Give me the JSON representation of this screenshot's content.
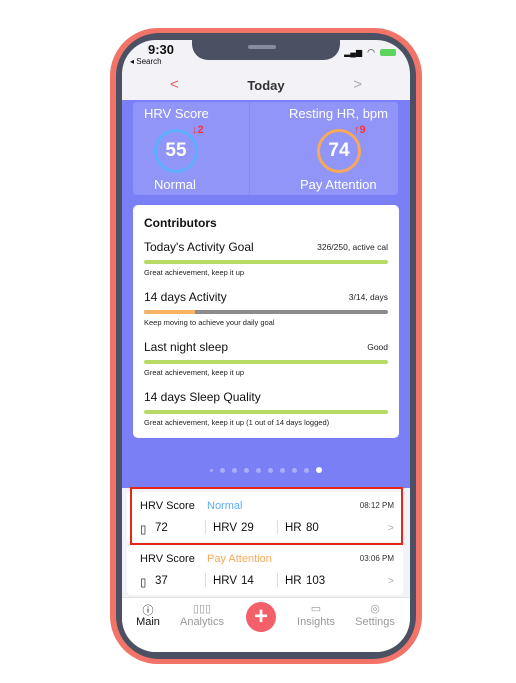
{
  "status": {
    "time": "9:30",
    "back": "◂ Search"
  },
  "nav": {
    "prev": "<",
    "title": "Today",
    "next": ">"
  },
  "hrv": {
    "label": "HRV Score",
    "value": "55",
    "delta": "↓2",
    "status": "Normal",
    "ring_color": "#5aaefc"
  },
  "rhr": {
    "label": "Resting HR, bpm",
    "value": "74",
    "delta": "↑9",
    "status": "Pay Attention",
    "ring_color": "#f7a95a"
  },
  "contributors": {
    "title": "Contributors",
    "items": [
      {
        "name": "Today's Activity Goal",
        "value": "326/250, active cal",
        "progress": 1.0,
        "color": "#b8d964",
        "message": "Great achievement, keep it up"
      },
      {
        "name": "14 days Activity",
        "value": "3/14, days",
        "progress": 0.21,
        "color": "#f7b265",
        "message": "Keep moving to achieve your daily goal"
      },
      {
        "name": "Last night sleep",
        "value": "Good",
        "progress": 1.0,
        "color": "#b8d964",
        "message": "Great achievement, keep it up"
      },
      {
        "name": "14 days Sleep Quality",
        "value": "",
        "progress": 1.0,
        "color": "#b8d964",
        "message": "Great achievement, keep it up (1 out of 14 days logged)"
      }
    ]
  },
  "pager": {
    "count": 10,
    "active": 9
  },
  "entries": [
    {
      "label": "HRV Score",
      "status": "Normal",
      "status_color": "#5aaefc",
      "time": "08:12 PM",
      "score": "72",
      "hrv_label": "HRV",
      "hrv": "29",
      "hr_label": "HR",
      "hr": "80",
      "chevron": ">"
    },
    {
      "label": "HRV Score",
      "status": "Pay Attention",
      "status_color": "#f7a95a",
      "time": "03:06 PM",
      "score": "37",
      "hrv_label": "HRV",
      "hrv": "14",
      "hr_label": "HR",
      "hr": "103",
      "chevron": ">"
    }
  ],
  "tabs": [
    {
      "label": "Main",
      "icon": "info-icon"
    },
    {
      "label": "Analytics",
      "icon": "bar-chart-icon"
    },
    {
      "label": "+",
      "icon": "plus-icon"
    },
    {
      "label": "Insights",
      "icon": "book-icon"
    },
    {
      "label": "Settings",
      "icon": "gear-icon"
    }
  ]
}
